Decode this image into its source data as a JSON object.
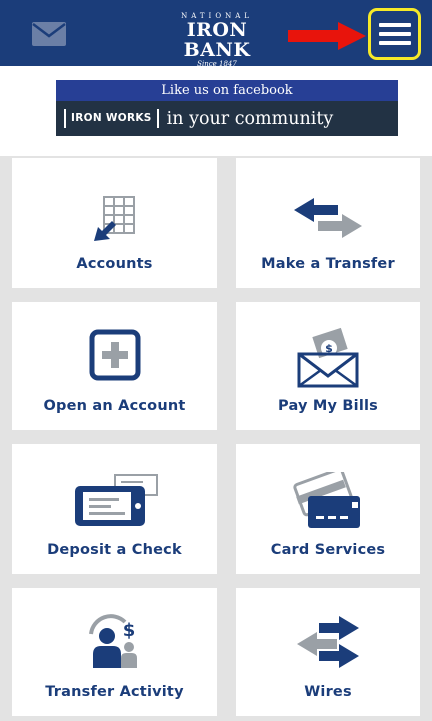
{
  "header": {
    "logo": {
      "top_text": "NATIONAL",
      "name": "IRON BANK",
      "since": "Since 1847"
    },
    "icons": {
      "mail": "mail-icon",
      "menu": "hamburger-menu-icon",
      "arrow": "red-arrow-annotation"
    }
  },
  "promo": {
    "headline": "Like us on facebook",
    "badge": "IRON WORKS",
    "tagline": "in your community"
  },
  "tiles": [
    {
      "label": "Accounts",
      "icon": "accounts-ledger-icon"
    },
    {
      "label": "Make a Transfer",
      "icon": "transfer-arrows-icon"
    },
    {
      "label": "Open an Account",
      "icon": "plus-square-icon"
    },
    {
      "label": "Pay My Bills",
      "icon": "bill-envelope-icon"
    },
    {
      "label": "Deposit a Check",
      "icon": "mobile-check-deposit-icon"
    },
    {
      "label": "Card Services",
      "icon": "credit-card-icon"
    },
    {
      "label": "Transfer Activity",
      "icon": "person-dollar-icon"
    },
    {
      "label": "Wires",
      "icon": "wire-arrows-icon"
    }
  ],
  "colors": {
    "brand_navy": "#1b3d7a",
    "accent_gray": "#9aa0a6",
    "highlight_yellow": "#f6e928",
    "annotation_red": "#e8140c",
    "page_gray": "#e3e3e3"
  }
}
